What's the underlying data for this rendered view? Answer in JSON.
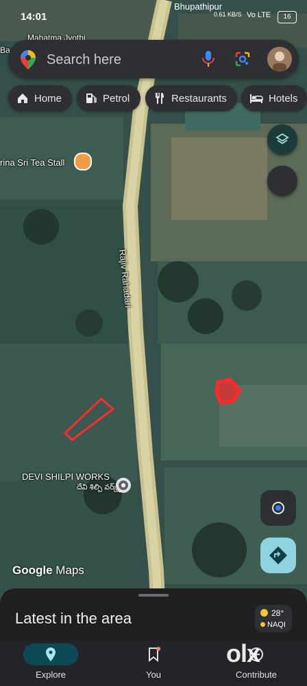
{
  "status_bar": {
    "time": "14:01",
    "place": "Bhupathipur",
    "network": "0.61 KB/S",
    "signal": "Vo LTE",
    "battery": "16"
  },
  "map_labels": {
    "top_left": "Mahatma Jyothi",
    "left_edge": "Ba",
    "tea_stall": "rina Sri Tea Stall",
    "road": "Rajiv Rahadari",
    "poi": "DEVI SHILPI WORKS",
    "poi_local": "దేవి శిల్పి వర్క్స్"
  },
  "search": {
    "placeholder": "Search here"
  },
  "chips": [
    {
      "label": "Home",
      "icon": "home-icon"
    },
    {
      "label": "Petrol",
      "icon": "fuel-icon"
    },
    {
      "label": "Restaurants",
      "icon": "restaurant-icon"
    },
    {
      "label": "Hotels",
      "icon": "hotel-icon"
    }
  ],
  "brand": {
    "google": "Google",
    "maps": "Maps"
  },
  "sheet": {
    "title": "Latest in the area",
    "temperature": "28°",
    "aqi": "NAQI"
  },
  "bottom_nav": [
    {
      "label": "Explore",
      "active": true
    },
    {
      "label": "You",
      "active": false
    },
    {
      "label": "Contribute",
      "active": false
    }
  ],
  "watermark": "olx",
  "colors": {
    "accent": "#3aa3ff",
    "chip_bg": "#2d2f33",
    "route_fab": "#8fd3e0",
    "annotation": "#ff2b2b"
  }
}
